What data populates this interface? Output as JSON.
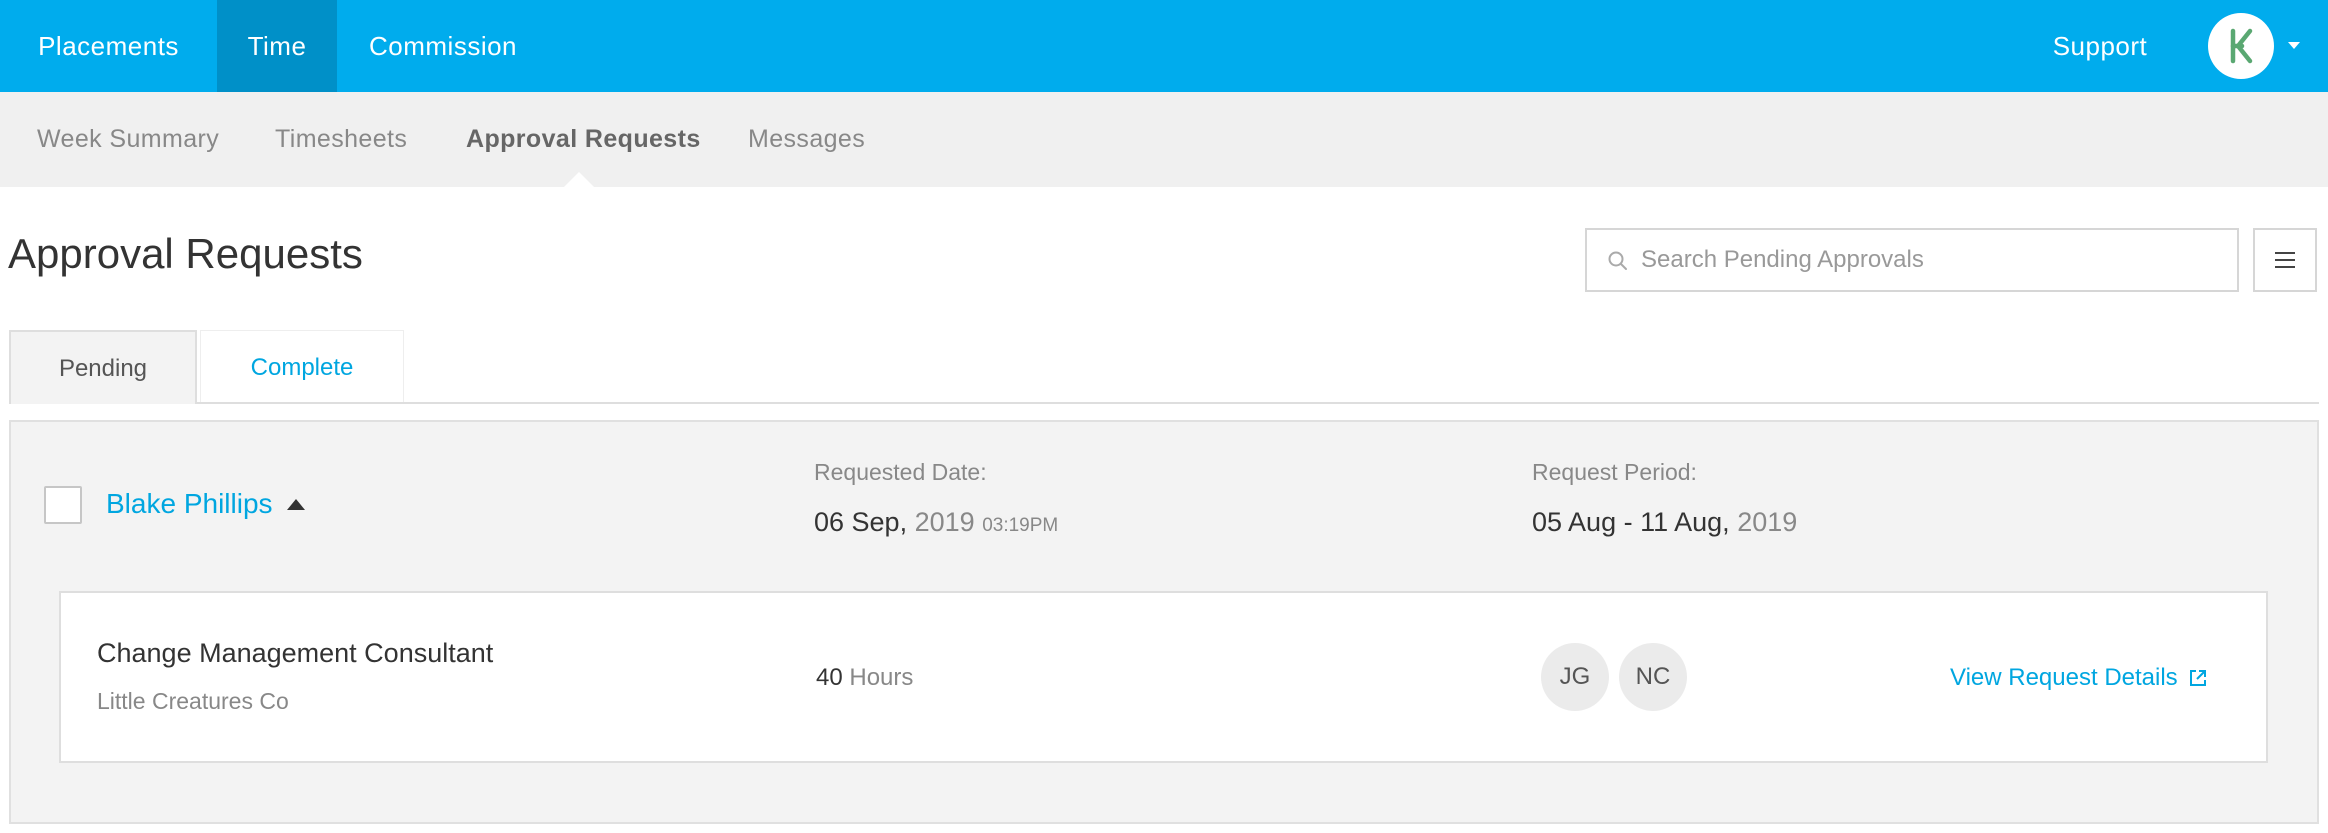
{
  "topnav": {
    "items": [
      {
        "label": "Placements",
        "active": false
      },
      {
        "label": "Time",
        "active": true
      },
      {
        "label": "Commission",
        "active": false
      }
    ],
    "support_label": "Support",
    "avatar_icon": "brand-logo-icon"
  },
  "subnav": {
    "items": [
      {
        "label": "Week Summary",
        "active": false
      },
      {
        "label": "Timesheets",
        "active": false
      },
      {
        "label": "Approval Requests",
        "active": true
      },
      {
        "label": "Messages",
        "active": false
      }
    ]
  },
  "page": {
    "title": "Approval Requests",
    "search": {
      "placeholder": "Search Pending Approvals",
      "value": ""
    }
  },
  "tabs": [
    {
      "label": "Pending",
      "active": true
    },
    {
      "label": "Complete",
      "active": false
    }
  ],
  "request": {
    "employee_name": "Blake Phillips",
    "requested_date_label": "Requested Date:",
    "requested_date": {
      "day_month": "06 Sep,",
      "year": "2019",
      "time": "03:19PM"
    },
    "request_period_label": "Request Period:",
    "request_period": {
      "range": "05 Aug - 11 Aug,",
      "year": "2019"
    },
    "item": {
      "job_title": "Change Management Consultant",
      "company": "Little Creatures Co",
      "hours_value": "40",
      "hours_unit": "Hours",
      "approvers": [
        "JG",
        "NC"
      ],
      "view_link_label": "View Request Details"
    }
  },
  "colors": {
    "brand_blue": "#00aced",
    "active_nav": "#0090c8",
    "link_blue": "#00a6e0",
    "logo_green": "#5aa872"
  }
}
